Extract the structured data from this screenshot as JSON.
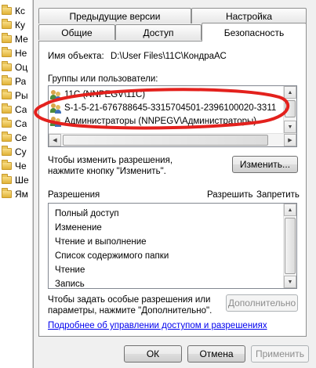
{
  "explorer": {
    "items": [
      "Кс",
      "Ку",
      "Ме",
      "Не",
      "Оц",
      "Ра",
      "Ры",
      "Са",
      "Са",
      "Се",
      "Су",
      "Че",
      "Ше",
      "Ям"
    ]
  },
  "tabs": {
    "row1": [
      "Предыдущие версии",
      "Настройка"
    ],
    "row2": [
      "Общие",
      "Доступ",
      "Безопасность"
    ]
  },
  "security": {
    "object_label": "Имя объекта:",
    "object_value": "D:\\User Files\\11C\\КондраАС",
    "groups_label": "Группы или пользователи:",
    "users": [
      "11C (NNPEGV\\11C)",
      "S-1-5-21-676788645-3315704501-2396100020-3311",
      "Администраторы (NNPEGV\\Администраторы)"
    ],
    "change_hint_line1": "Чтобы изменить разрешения,",
    "change_hint_line2": "нажмите кнопку \"Изменить\".",
    "change_button": "Изменить...",
    "perm_header": "Разрешения",
    "allow_header": "Разрешить",
    "deny_header": "Запретить",
    "permissions": [
      "Полный доступ",
      "Изменение",
      "Чтение и выполнение",
      "Список содержимого папки",
      "Чтение",
      "Запись"
    ],
    "advanced_hint_line1": "Чтобы задать особые разрешения или",
    "advanced_hint_line2": "параметры, нажмите \"Дополнительно\".",
    "advanced_button": "Дополнительно",
    "help_link": "Подробнее об управлении доступом и разрешениях"
  },
  "footer": {
    "ok": "ОК",
    "cancel": "Отмена",
    "apply": "Применить"
  },
  "colors": {
    "annotation": "#e3211d",
    "link": "#0000ee"
  }
}
